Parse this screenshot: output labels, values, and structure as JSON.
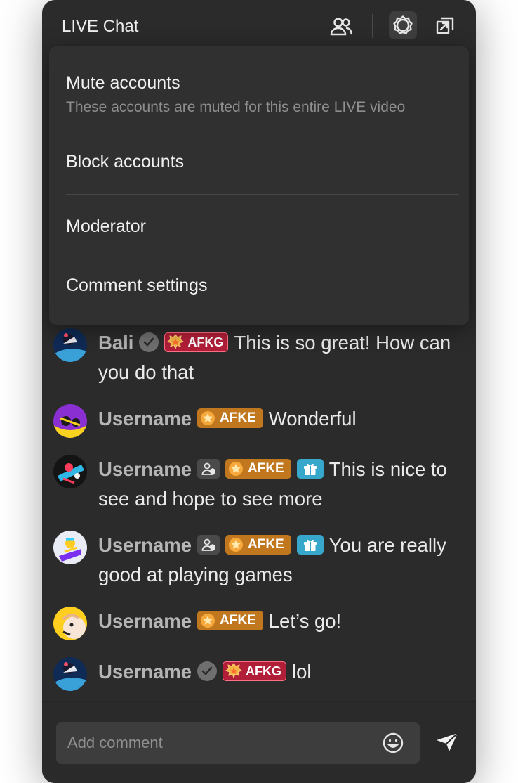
{
  "header": {
    "title": "LIVE Chat",
    "icons": [
      "people-icon",
      "settings-icon",
      "popout-icon"
    ]
  },
  "menu": {
    "items": [
      {
        "label": "Mute accounts",
        "desc": "These accounts are muted for this entire LIVE video"
      },
      {
        "label": "Block accounts"
      },
      {
        "label": "Moderator"
      },
      {
        "label": "Comment settings"
      }
    ]
  },
  "messages": [
    {
      "user": "Bali",
      "badges": [
        "verified",
        "AFKG"
      ],
      "text": "This is so great! How can you do that"
    },
    {
      "user": "Username",
      "badges": [
        "AFKE"
      ],
      "text": "Wonderful"
    },
    {
      "user": "Username",
      "badges": [
        "moderator",
        "AFKE",
        "gift"
      ],
      "text": "This is nice to see and hope to see more"
    },
    {
      "user": "Username",
      "badges": [
        "moderator",
        "AFKE",
        "gift"
      ],
      "text": "You are really good at playing games"
    },
    {
      "user": "Username",
      "badges": [
        "AFKE"
      ],
      "text": "Let’s go!"
    },
    {
      "user": "Username",
      "badges": [
        "verified",
        "AFKG"
      ],
      "text": "lol"
    }
  ],
  "badges": {
    "afke": "AFKE",
    "afkg": "AFKG"
  },
  "composer": {
    "placeholder": "Add comment"
  },
  "colors": {
    "panel": "#2b2b2b",
    "afke": "#c0771e",
    "afkg": "#b11e37",
    "gift": "#37a8cc"
  }
}
